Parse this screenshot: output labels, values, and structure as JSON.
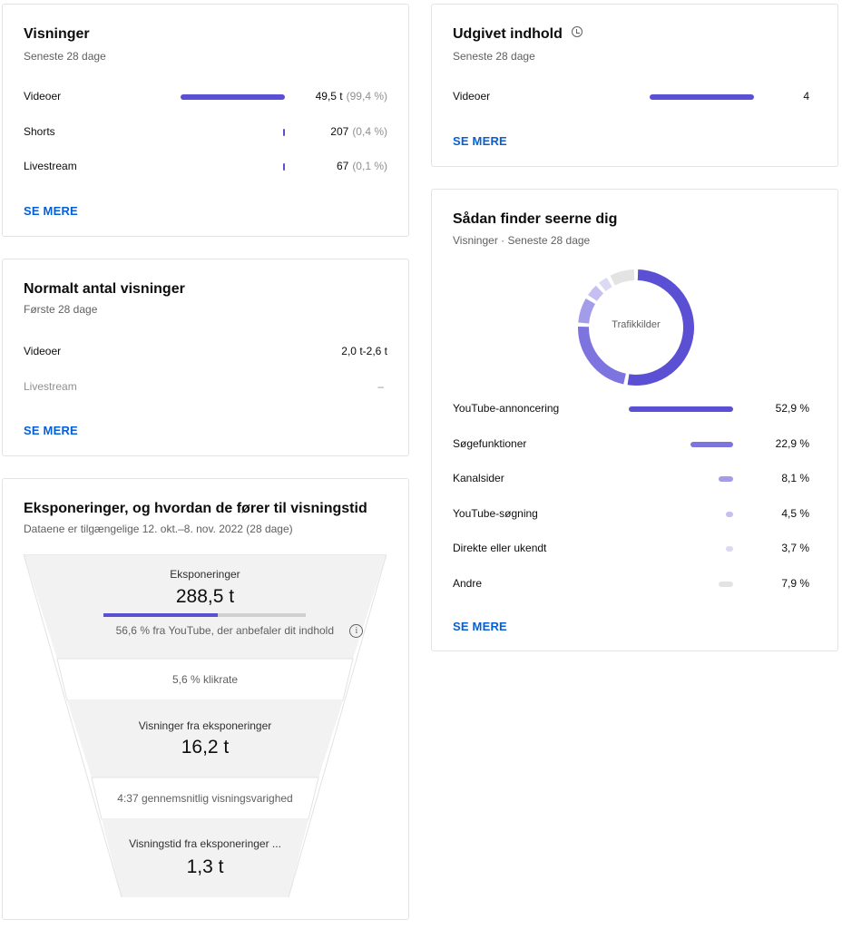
{
  "views_card": {
    "title": "Visninger",
    "subtitle": "Seneste 28 dage",
    "rows": [
      {
        "label": "Videoer",
        "value": "49,5 t",
        "pct": "(99,4 %)",
        "share": 0.994
      },
      {
        "label": "Shorts",
        "value": "207",
        "pct": "(0,4 %)",
        "share": 0.004
      },
      {
        "label": "Livestream",
        "value": "67",
        "pct": "(0,1 %)",
        "share": 0.001
      }
    ],
    "see_more": "SE MERE"
  },
  "typical_card": {
    "title": "Normalt antal visninger",
    "subtitle": "Første 28 dage",
    "rows": [
      {
        "label": "Videoer",
        "value": "2,0 t-2,6 t"
      },
      {
        "label": "Livestream",
        "value": "–"
      }
    ],
    "see_more": "SE MERE"
  },
  "impressions_card": {
    "title": "Eksponeringer, og hvordan de fører til visningstid",
    "subtitle": "Dataene er tilgængelige 12. okt.–8. nov. 2022 (28 dage)",
    "impressions_label": "Eksponeringer",
    "impressions_value": "288,5 t",
    "recommended_share": 0.566,
    "recommended_text": "56,6 % fra YouTube, der anbefaler dit indhold",
    "ctr_text": "5,6 % klikrate",
    "views_label": "Visninger fra eksponeringer",
    "views_value": "16,2 t",
    "avg_duration_text": "4:37 gennemsnitlig visningsvarighed",
    "watch_time_label": "Visningstid fra eksponeringer ...",
    "watch_time_value": "1,3 t"
  },
  "published_card": {
    "title": "Udgivet indhold",
    "subtitle": "Seneste 28 dage",
    "rows": [
      {
        "label": "Videoer",
        "value": "4",
        "share": 1.0
      }
    ],
    "see_more": "SE MERE"
  },
  "traffic_card": {
    "title": "Sådan finder seerne dig",
    "subtitle": "Visninger · Seneste 28 dage",
    "donut_label": "Trafikkilder",
    "see_more": "SE MERE",
    "colors": {
      "primary": "#5b4fd4",
      "secondary": "#7d74e0",
      "tertiary": "#a39ce9",
      "quaternary": "#c5c0f1",
      "light": "#dcdaf2",
      "grey": "#e3e3e3"
    }
  },
  "chart_data": {
    "type": "pie",
    "title": "Trafikkilder",
    "categories": [
      "YouTube-annoncering",
      "Søgefunktioner",
      "Kanalsider",
      "YouTube-søgning",
      "Direkte eller ukendt",
      "Andre"
    ],
    "values": [
      52.9,
      22.9,
      8.1,
      4.5,
      3.7,
      7.9
    ],
    "value_labels": [
      "52,9 %",
      "22,9 %",
      "8,1 %",
      "4,5 %",
      "3,7 %",
      "7,9 %"
    ],
    "colors": [
      "#5b4fd4",
      "#7d74e0",
      "#a39ce9",
      "#c5c0f1",
      "#dcdaf2",
      "#e3e3e3"
    ]
  }
}
